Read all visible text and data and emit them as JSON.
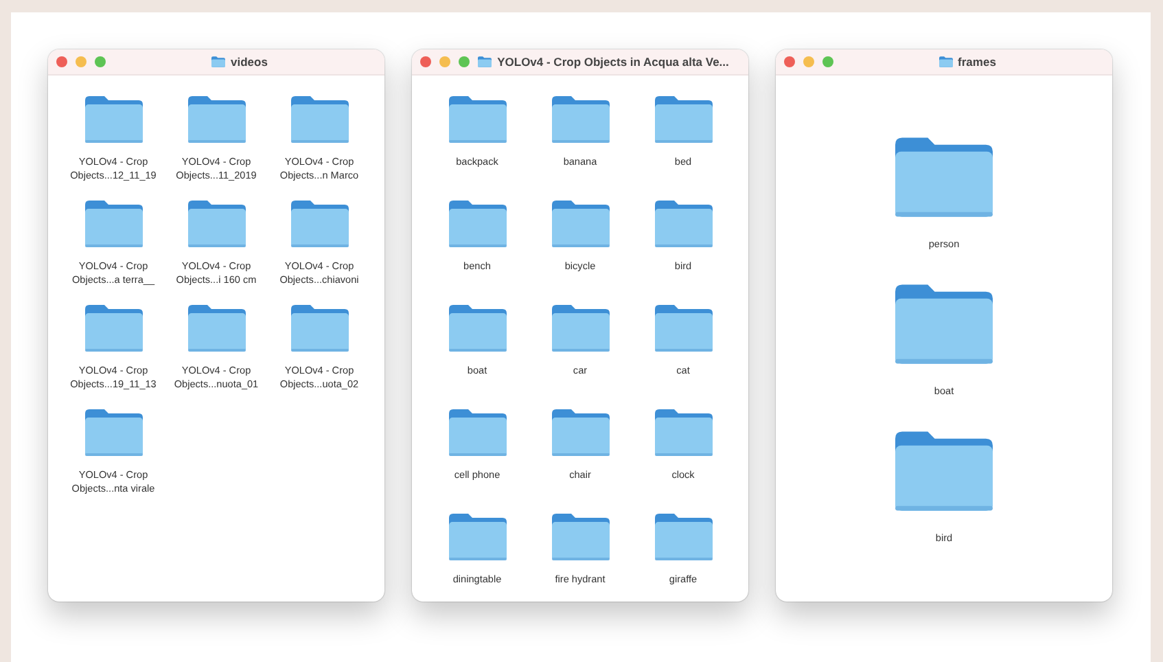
{
  "windows": [
    {
      "title": "videos",
      "kind": "grid",
      "items": [
        "YOLOv4 - Crop\nObjects...12_11_19",
        "YOLOv4 - Crop\nObjects...11_2019",
        "YOLOv4 - Crop\nObjects...n Marco",
        "YOLOv4 - Crop\nObjects...a terra__",
        "YOLOv4 - Crop\nObjects...i 160 cm",
        "YOLOv4 - Crop\nObjects...chiavoni",
        "YOLOv4 - Crop\nObjects...19_11_13",
        "YOLOv4 - Crop\nObjects...nuota_01",
        "YOLOv4 - Crop\nObjects...uota_02",
        "YOLOv4 - Crop\nObjects...nta virale"
      ]
    },
    {
      "title": "YOLOv4 - Crop Objects in Acqua alta Ve...",
      "kind": "grid",
      "items": [
        "backpack",
        "banana",
        "bed",
        "bench",
        "bicycle",
        "bird",
        "boat",
        "car",
        "cat",
        "cell phone",
        "chair",
        "clock",
        "diningtable",
        "fire hydrant",
        "giraffe"
      ]
    },
    {
      "title": "frames",
      "kind": "column",
      "items": [
        "person",
        "boat",
        "bird"
      ]
    }
  ]
}
